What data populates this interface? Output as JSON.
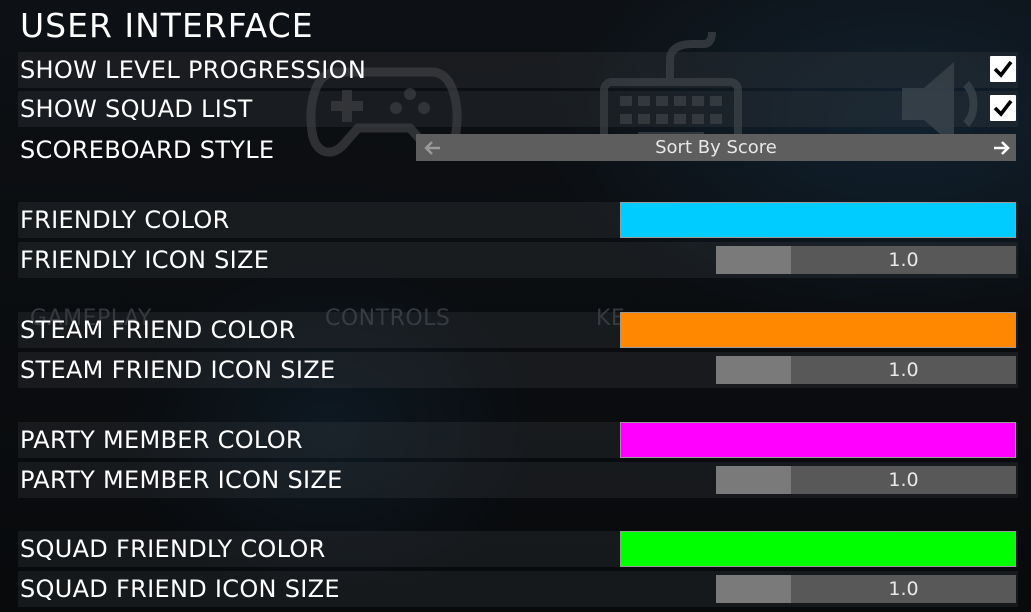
{
  "page": {
    "title": "USER INTERFACE"
  },
  "background": {
    "tabs": [
      "GAMEPLAY",
      "CONTROLS",
      "KE"
    ],
    "icons": [
      "gamepad-icon",
      "keyboard-icon",
      "speaker-icon"
    ]
  },
  "settings": {
    "show_level_progression": {
      "label": "SHOW LEVEL PROGRESSION",
      "checked": true,
      "icon": "checkmark-icon"
    },
    "show_squad_list": {
      "label": "SHOW SQUAD LIST",
      "checked": true,
      "icon": "checkmark-icon"
    },
    "scoreboard_style": {
      "label": "SCOREBOARD STYLE",
      "value": "Sort By Score",
      "prev_icon": "arrow-left-icon",
      "next_icon": "arrow-right-icon"
    },
    "friendly_color": {
      "label": "FRIENDLY COLOR",
      "color": "#00ccff"
    },
    "friendly_icon_size": {
      "label": "FRIENDLY ICON SIZE",
      "value": "1.0",
      "fill_fraction": 0.25
    },
    "steam_friend_color": {
      "label": "STEAM FRIEND COLOR",
      "color": "#ff8800"
    },
    "steam_friend_icon_size": {
      "label": "STEAM FRIEND ICON SIZE",
      "value": "1.0",
      "fill_fraction": 0.25
    },
    "party_member_color": {
      "label": "PARTY MEMBER COLOR",
      "color": "#ff00ff"
    },
    "party_member_icon_size": {
      "label": "PARTY MEMBER ICON SIZE",
      "value": "1.0",
      "fill_fraction": 0.25
    },
    "squad_friendly_color": {
      "label": "SQUAD FRIENDLY COLOR",
      "color": "#00ff00"
    },
    "squad_friend_icon_size": {
      "label": "SQUAD FRIEND ICON SIZE",
      "value": "1.0",
      "fill_fraction": 0.25
    }
  }
}
